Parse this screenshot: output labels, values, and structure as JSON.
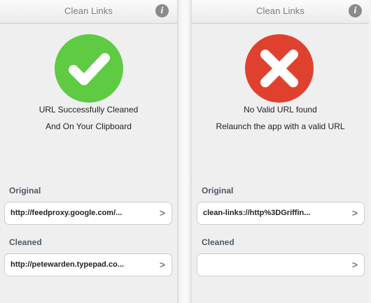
{
  "screens": [
    {
      "title": "Clean Links",
      "status": "success",
      "message_line1": "URL Successfully Cleaned",
      "message_line2": "And On Your Clipboard",
      "original_label": "Original",
      "original_value": "http://feedproxy.google.com/...",
      "cleaned_label": "Cleaned",
      "cleaned_value": "http://petewarden.typepad.co..."
    },
    {
      "title": "Clean Links",
      "status": "error",
      "message_line1": "No Valid URL found",
      "message_line2": "Relaunch the app with a valid URL",
      "original_label": "Original",
      "original_value": "clean-links://http%3DGriffin...",
      "cleaned_label": "Cleaned",
      "cleaned_value": ""
    }
  ],
  "icons": {
    "info": "info-icon",
    "success": "checkmark-icon",
    "error": "x-icon",
    "chevron": "chevron-right-icon"
  },
  "colors": {
    "success": "#5ecb43",
    "error": "#e0412f"
  }
}
